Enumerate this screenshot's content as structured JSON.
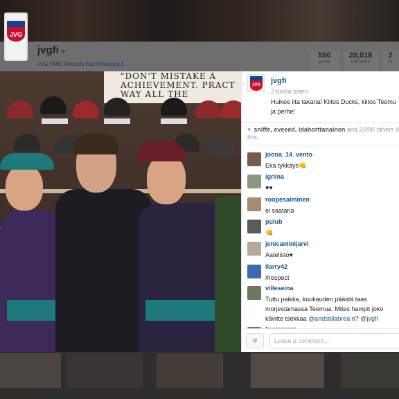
{
  "profile": {
    "username": "jvgfi",
    "dropdown_icon": "chevron-down-icon",
    "bio_text": "JVG PME Records",
    "bio_link": "http://www.jvg.fi",
    "stats": [
      {
        "value": "550",
        "label": "posts"
      },
      {
        "value": "20,018",
        "label": "followers"
      },
      {
        "value": "2",
        "label": "fo"
      }
    ]
  },
  "photo": {
    "quote_lines": [
      "\"DON'T MISTAKE A",
      "ACHIEVEMENT. PRACT",
      "WAY ALL THE"
    ]
  },
  "post": {
    "username": "jvgfi",
    "time": "2 tuntia sitten",
    "caption": "Huikee ilta takana! Kiitos Ducks, kiitos Teemu ja perhe!",
    "likes_names": "sniffe, eveeed, idahorttanainen",
    "likes_rest": " and 3,090 others like this."
  },
  "comments": [
    {
      "user": "joona_14_vento",
      "text": "Eka tykkäys👊",
      "avatar_color": "#7a5a48"
    },
    {
      "user": "igriina",
      "text": "♥♥",
      "avatar_color": "#8a9a7a"
    },
    {
      "user": "roopesaiminen",
      "text": "ei saatana",
      "avatar_color": "#a88a70"
    },
    {
      "user": "pulub",
      "text": "👊",
      "avatar_color": "#5a5a5a"
    },
    {
      "user": "jenicanlinijarvi",
      "text": "Aatelisto♥",
      "avatar_color": "#b8a898"
    },
    {
      "user": "llarry42",
      "text": "#respect",
      "avatar_color": "#3a6ab0"
    },
    {
      "user": "villeseina",
      "text": "Tuttu paikka, kuukauden päästä taas morjestamassa Teemua. Mites hampit joko kävitte tsekkaa",
      "mention": "@andstillabrea",
      "text_after": " n? ",
      "mention2": "@jvgfi",
      "avatar_color": "#6a7a5a"
    },
    {
      "user": "lauraavara",
      "text": "",
      "avatar_color": "#8a6a5a"
    }
  ],
  "comment_box": {
    "placeholder": "Leave a comment...",
    "like_icon": "heart-icon"
  },
  "colors": {
    "link": "#125688",
    "logo_blue": "#1c3f8a",
    "logo_red": "#c8102e"
  }
}
